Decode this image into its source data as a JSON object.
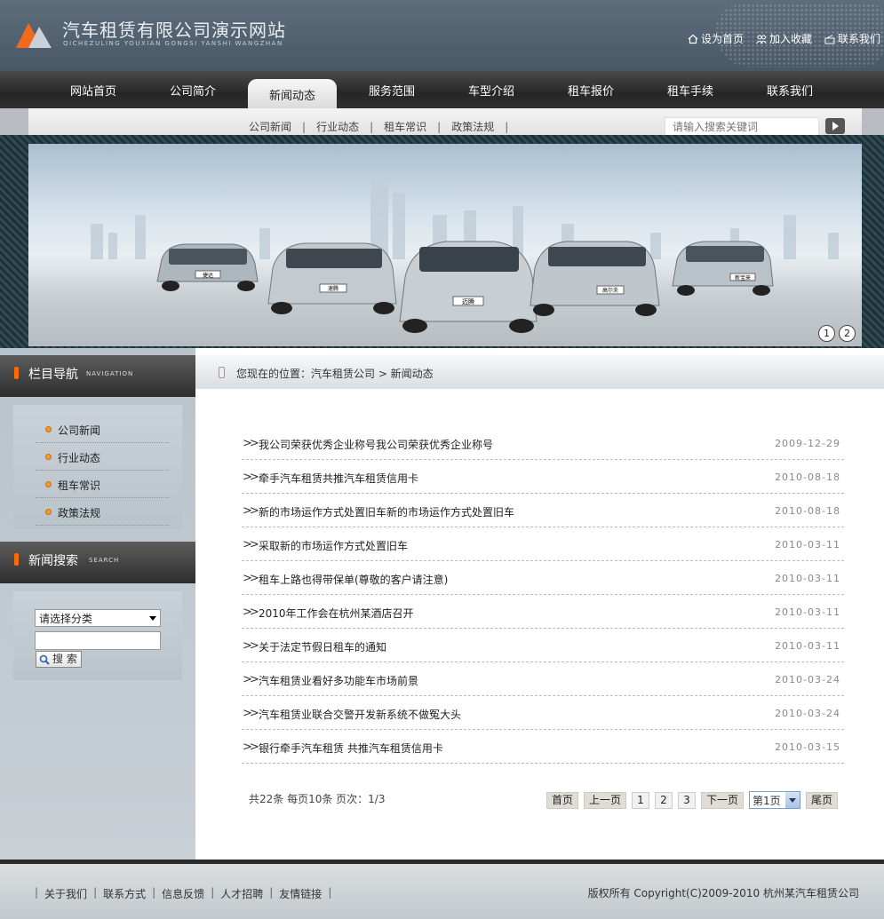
{
  "header": {
    "title": "汽车租赁有限公司演示网站",
    "subtitle": "QICHEZULING YOUXIAN GONGSI YANSHI WANGZHAN",
    "links": [
      "设为首页",
      "加入收藏",
      "联系我们"
    ]
  },
  "nav": {
    "items": [
      "网站首页",
      "公司简介",
      "新闻动态",
      "服务范围",
      "车型介绍",
      "租车报价",
      "租车手续",
      "联系我们"
    ],
    "active_index": 2
  },
  "subnav": {
    "links": [
      "公司新闻",
      "行业动态",
      "租车常识",
      "政策法规"
    ],
    "search_placeholder": "请输入搜索关键词"
  },
  "banner": {
    "plates": [
      "捷达",
      "速腾",
      "迈腾",
      "高尔夫",
      "新宝来"
    ],
    "dots": [
      "1",
      "2"
    ]
  },
  "sidebar": {
    "nav_title": "栏目导航",
    "nav_title_en": "NAVIGATION",
    "categories": [
      "公司新闻",
      "行业动态",
      "租车常识",
      "政策法规"
    ],
    "search_title": "新闻搜索",
    "search_title_en": "SEARCH",
    "select_value": "请选择分类",
    "search_button": "搜 索"
  },
  "breadcrumb": {
    "text": "您现在的位置：汽车租赁公司 > 新闻动态"
  },
  "news": [
    {
      "title": "我公司荣获优秀企业称号我公司荣获优秀企业称号",
      "date": "2009-12-29"
    },
    {
      "title": "牵手汽车租赁共推汽车租赁信用卡",
      "date": "2010-08-18"
    },
    {
      "title": "新的市场运作方式处置旧车新的市场运作方式处置旧车",
      "date": "2010-08-18"
    },
    {
      "title": "采取新的市场运作方式处置旧车",
      "date": "2010-03-11"
    },
    {
      "title": "租车上路也得带保单(尊敬的客户请注意)",
      "date": "2010-03-11"
    },
    {
      "title": "2010年工作会在杭州某酒店召开",
      "date": "2010-03-11"
    },
    {
      "title": "关于法定节假日租车的通知",
      "date": "2010-03-11"
    },
    {
      "title": "汽车租赁业看好多功能车市场前景",
      "date": "2010-03-24"
    },
    {
      "title": "汽车租赁业联合交警开发新系统不做冤大头",
      "date": "2010-03-24"
    },
    {
      "title": "银行牵手汽车租赁 共推汽车租赁信用卡",
      "date": "2010-03-15"
    }
  ],
  "pagination": {
    "info": "共22条  每页10条  页次：1/3",
    "first": "首页",
    "prev": "上一页",
    "pages": [
      "1",
      "2",
      "3"
    ],
    "next": "下一页",
    "select_value": "第1页",
    "last": "尾页"
  },
  "footer": {
    "links": [
      "关于我们",
      "联系方式",
      "信息反馈",
      "人才招聘",
      "友情链接"
    ],
    "copyright": "版权所有  Copyright(C)2009-2010 杭州某汽车租赁公司"
  },
  "colors": {
    "header_bg": "#536270",
    "nav_bg": "#2e2e2e",
    "accent_orange": "#ff6a00",
    "bullet_orange": "#f79a2b"
  }
}
